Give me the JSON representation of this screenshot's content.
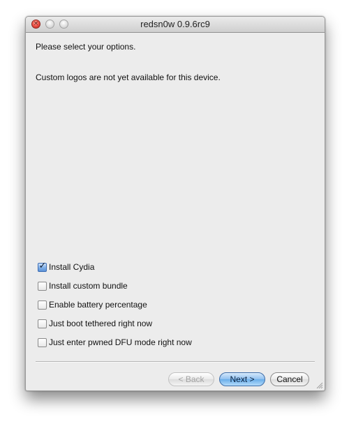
{
  "window": {
    "title": "redsn0w 0.9.6rc9",
    "controls": {
      "close_icon": "close-icon",
      "close_glyph": "×",
      "minimize_icon": "minimize-icon",
      "zoom_icon": "zoom-icon"
    }
  },
  "content": {
    "prompt": "Please select your options.",
    "logo_note": "Custom logos are not yet available for this device."
  },
  "options": [
    {
      "label": "Install Cydia",
      "checked": true
    },
    {
      "label": "Install custom bundle",
      "checked": false
    },
    {
      "label": "Enable battery percentage",
      "checked": false
    },
    {
      "label": "Just boot tethered right now",
      "checked": false
    },
    {
      "label": "Just enter pwned DFU mode right now",
      "checked": false
    }
  ],
  "checkmark_glyph": "✓",
  "buttons": {
    "back": "< Back",
    "next": "Next >",
    "cancel": "Cancel"
  },
  "colors": {
    "close_button": "#f0554a",
    "default_button": "#6aaeea",
    "window_background": "#ececec"
  }
}
